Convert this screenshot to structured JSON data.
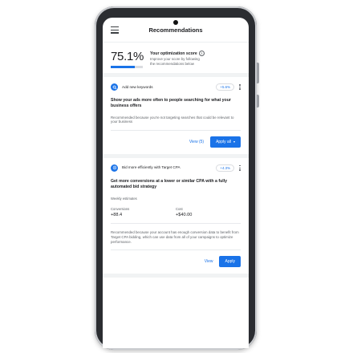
{
  "appbar": {
    "title": "Recommendations"
  },
  "score": {
    "value_text": "75.1%",
    "value": 75.1,
    "heading": "Your optimization score",
    "description": "Improve your score by following the recommendations below"
  },
  "cards": [
    {
      "icon": "search-icon",
      "title": "Add new keywords",
      "uplift": "+5.6%",
      "headline": "Show your ads more often to people searching for what your business offers",
      "body": "Recommended because you're not targeting searches that could be relevant to your business",
      "secondary_label": "View (5)",
      "primary_label": "Apply all"
    },
    {
      "icon": "target-icon",
      "title": "Bid more efficiently with Target CPA",
      "uplift": "+4.3%",
      "headline": "Get more conversions at a lower or similar CPA with a fully automated bid strategy",
      "estimates_label": "Weekly estimates",
      "metrics": [
        {
          "label": "Conversions",
          "value": "+88.4"
        },
        {
          "label": "Cost",
          "value": "+$40.00"
        }
      ],
      "body": "Recommended because your account has enough conversion data to benefit from Target CPA bidding, which can use data from all of your campaigns to optimize performance.",
      "secondary_label": "View",
      "primary_label": "Apply"
    }
  ],
  "colors": {
    "accent": "#1a73e8",
    "text": "#202124",
    "muted": "#5f6368"
  }
}
